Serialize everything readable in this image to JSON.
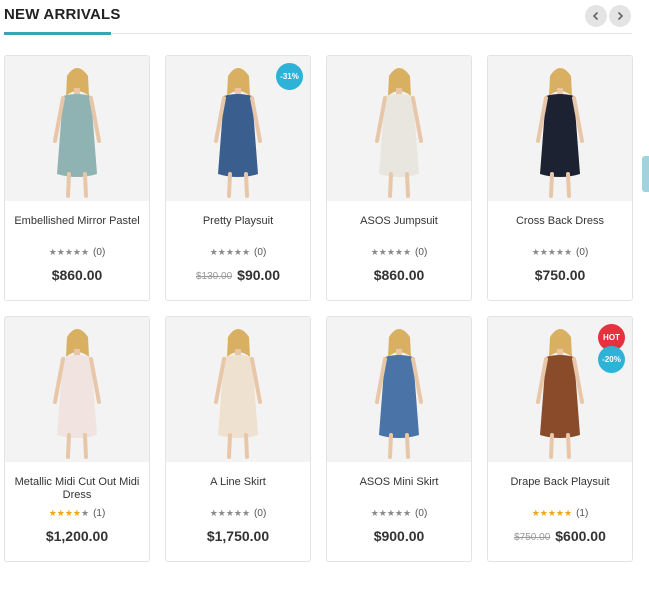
{
  "section": {
    "title": "NEW ARRIVALS",
    "prev_icon": "chevron-left-icon",
    "next_icon": "chevron-right-icon"
  },
  "colors": {
    "accent": "#3aa3b6",
    "sale_badge": "#2fb2d8",
    "hot_badge": "#e5323e",
    "star_active": "#f0a31c"
  },
  "products": [
    {
      "name": "Embellished Mirror Pastel",
      "rating": 0,
      "reviews": "(0)",
      "price": "$860.00",
      "old_price": "",
      "badges": [],
      "dress": "#8fb3b3"
    },
    {
      "name": "Pretty Playsuit",
      "rating": 0,
      "reviews": "(0)",
      "price": "$90.00",
      "old_price": "$130.00",
      "badges": [
        "-31%"
      ],
      "dress": "#3a5f8f"
    },
    {
      "name": "ASOS Jumpsuit",
      "rating": 0,
      "reviews": "(0)",
      "price": "$860.00",
      "old_price": "",
      "badges": [],
      "dress": "#e9e6df"
    },
    {
      "name": "Cross Back Dress",
      "rating": 0,
      "reviews": "(0)",
      "price": "$750.00",
      "old_price": "",
      "badges": [],
      "dress": "#1d2233"
    },
    {
      "name": "Metallic Midi Cut Out Midi Dress",
      "rating": 3.5,
      "reviews": "(1)",
      "price": "$1,200.00",
      "old_price": "",
      "badges": [],
      "dress": "#f1e4e0"
    },
    {
      "name": "A Line Skirt",
      "rating": 0,
      "reviews": "(0)",
      "price": "$1,750.00",
      "old_price": "",
      "badges": [],
      "dress": "#efe1cf"
    },
    {
      "name": "ASOS Mini Skirt",
      "rating": 0,
      "reviews": "(0)",
      "price": "$900.00",
      "old_price": "",
      "badges": [],
      "dress": "#4a73a8"
    },
    {
      "name": "Drape Back Playsuit",
      "rating": 5,
      "reviews": "(1)",
      "price": "$600.00",
      "old_price": "$750.00",
      "badges": [
        "HOT",
        "-20%"
      ],
      "dress": "#8a4b2a"
    }
  ]
}
